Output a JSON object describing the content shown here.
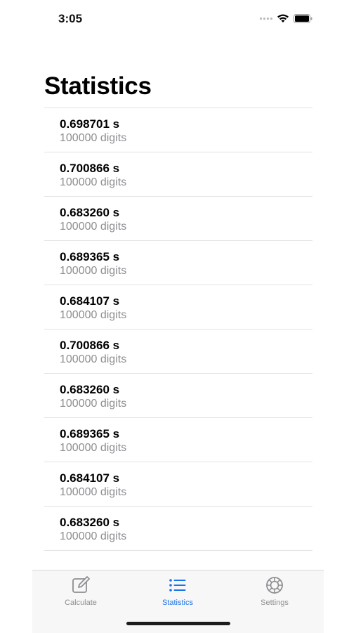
{
  "status_bar": {
    "time": "3:05"
  },
  "title": "Statistics",
  "results": [
    {
      "time": "0.698701 s",
      "digits": "100000 digits"
    },
    {
      "time": "0.700866 s",
      "digits": "100000 digits"
    },
    {
      "time": "0.683260 s",
      "digits": "100000 digits"
    },
    {
      "time": "0.689365 s",
      "digits": "100000 digits"
    },
    {
      "time": "0.684107 s",
      "digits": "100000 digits"
    },
    {
      "time": "0.700866 s",
      "digits": "100000 digits"
    },
    {
      "time": "0.683260 s",
      "digits": "100000 digits"
    },
    {
      "time": "0.689365 s",
      "digits": "100000 digits"
    },
    {
      "time": "0.684107 s",
      "digits": "100000 digits"
    },
    {
      "time": "0.683260 s",
      "digits": "100000 digits"
    }
  ],
  "tabs": [
    {
      "label": "Calculate",
      "icon": "compose-icon",
      "active": false
    },
    {
      "label": "Statistics",
      "icon": "list-icon",
      "active": true
    },
    {
      "label": "Settings",
      "icon": "gear-icon",
      "active": false
    }
  ],
  "colors": {
    "accent": "#1a73e8",
    "inactive": "#8e8e93"
  }
}
